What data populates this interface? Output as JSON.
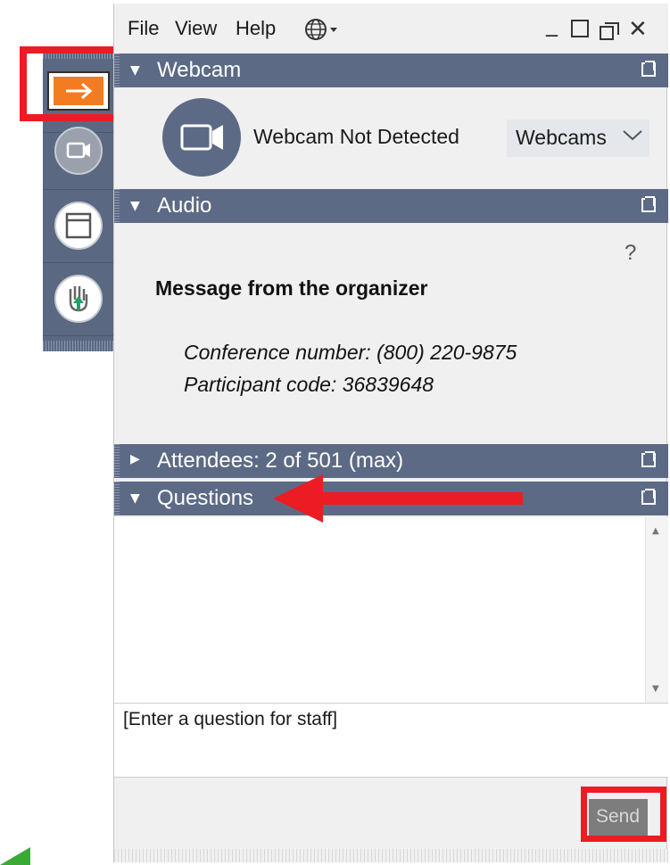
{
  "menu": {
    "file": "File",
    "view": "View",
    "help": "Help"
  },
  "window_controls": {
    "minimize": "_",
    "close": "✕"
  },
  "webcam": {
    "title": "Webcam",
    "status": "Webcam Not Detected",
    "selector": "Webcams"
  },
  "audio": {
    "title": "Audio",
    "help": "?",
    "message_title": "Message from the organizer",
    "conference_line": "Conference number: (800) 220-9875",
    "participant_line": "Participant code: 36839648"
  },
  "attendees": {
    "title": "Attendees:  2 of 501 (max)"
  },
  "questions": {
    "title": "Questions",
    "input_placeholder": "[Enter a question for staff]",
    "send_label": "Send"
  },
  "colors": {
    "panel_header": "#5c6a85",
    "highlight_red": "#ec1c24",
    "share_orange": "#f37c21"
  }
}
